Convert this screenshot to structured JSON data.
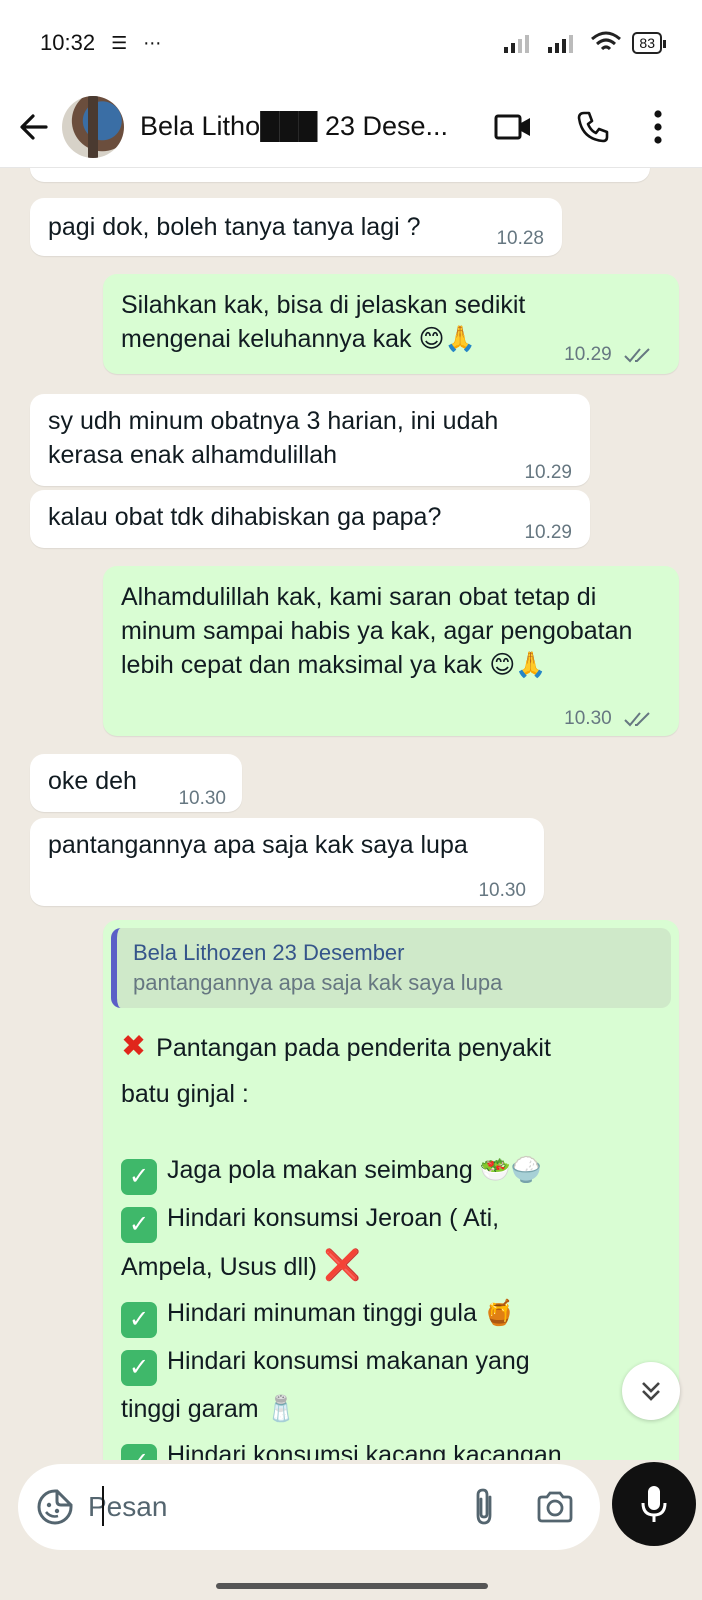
{
  "status_bar": {
    "time": "10:32",
    "battery": "83"
  },
  "header": {
    "contact_name": "Bela Litho███ 23 Dese..."
  },
  "messages": [
    {
      "direction": "in",
      "text": "pagi dok, boleh tanya tanya lagi ?",
      "time": "10.28"
    },
    {
      "direction": "out",
      "text": "Silahkan kak, bisa di jelaskan sedikit mengenai keluhannya kak",
      "emoji": "😊🙏",
      "time": "10.29",
      "status": "read"
    },
    {
      "direction": "in",
      "text": "sy udh minum obatnya 3 harian, ini udah kerasa enak alhamdulillah",
      "time": "10.29"
    },
    {
      "direction": "in",
      "text": "kalau obat tdk dihabiskan ga papa?",
      "time": "10.29"
    },
    {
      "direction": "out",
      "text": "Alhamdulillah kak, kami saran obat tetap di minum sampai habis ya kak, agar pengobatan lebih cepat dan maksimal ya kak",
      "emoji": "😊🙏",
      "time": "10.30",
      "status": "read"
    },
    {
      "direction": "in",
      "text": "oke deh",
      "time": "10.30"
    },
    {
      "direction": "in",
      "text": "pantangannya apa saja kak saya lupa",
      "time": "10.30"
    }
  ],
  "reply": {
    "quote_name": "Bela Lithozen 23 Desember",
    "quote_text": "pantangannya apa saja kak saya lupa",
    "heading_line1": "Pantangan pada penderita penyakit",
    "heading_line2": "batu ginjal :",
    "items": [
      {
        "text": "Jaga pola makan seimbang",
        "emoji": "🥗🍚"
      },
      {
        "text": "Hindari konsumsi Jeroan ( Ati,",
        "cont": "Ampela, Usus dll)",
        "emoji": "❌"
      },
      {
        "text": "Hindari minuman tinggi gula",
        "emoji": "🍯"
      },
      {
        "text": "Hindari konsumsi makanan yang",
        "cont": "tinggi garam",
        "emoji": "🧂"
      },
      {
        "text": "Hindari konsumsi kacang kacangan"
      }
    ]
  },
  "composer": {
    "placeholder": "Pesan"
  },
  "colors": {
    "chat_bg": "#efeae2",
    "outgoing_bubble": "#d9fdd3",
    "incoming_bubble": "#ffffff",
    "read_tick": "#667781",
    "check_icon": "#3fb86a",
    "quote_bar": "#5b5fc7"
  }
}
